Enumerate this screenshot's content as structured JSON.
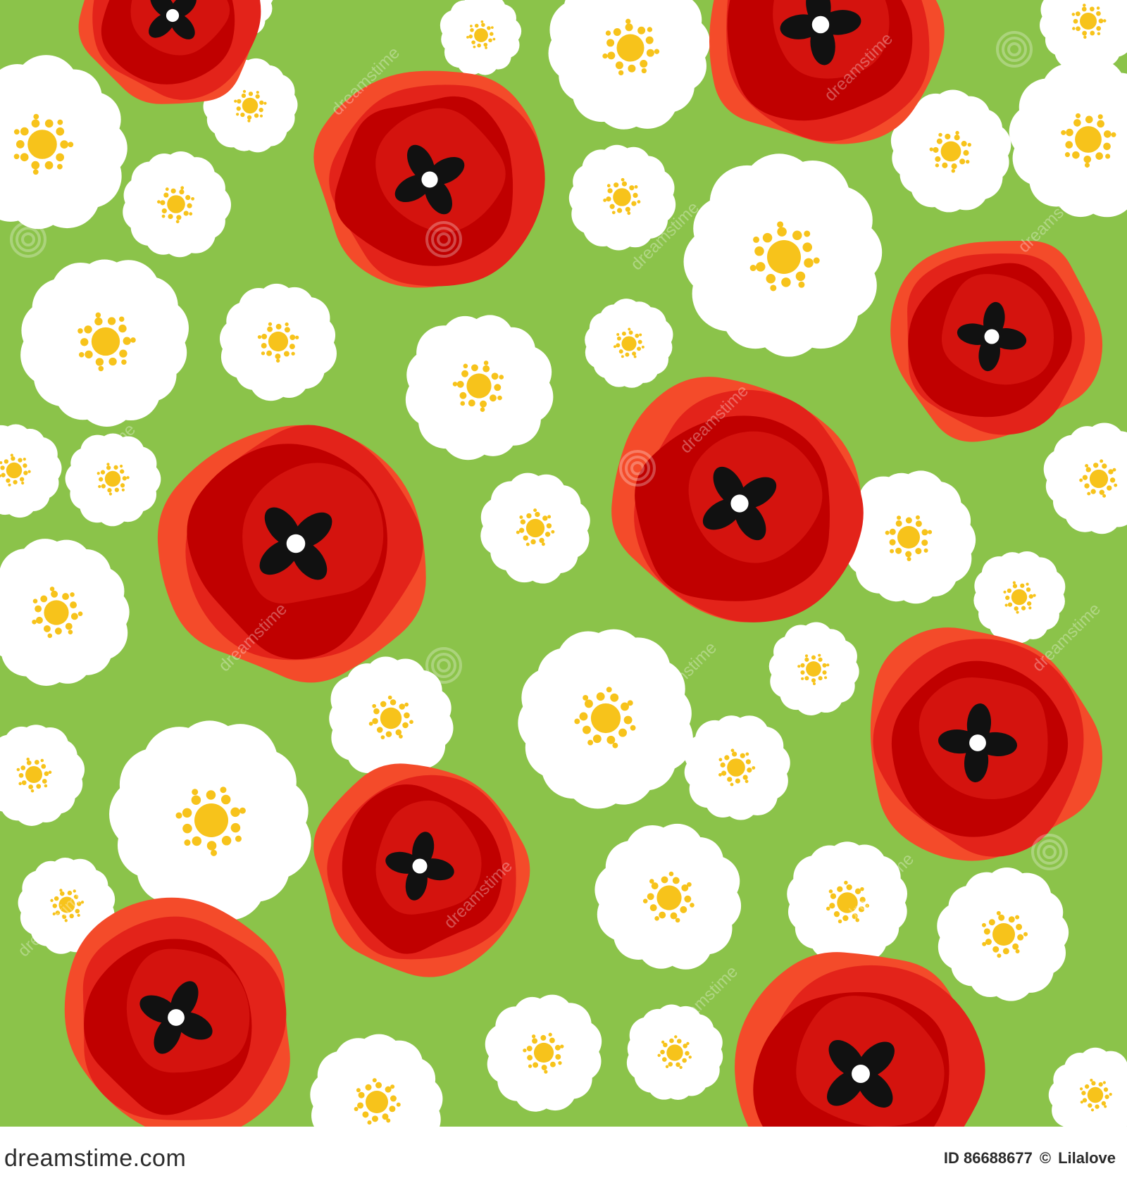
{
  "image": {
    "description": "",
    "background_color": "#8bc34a",
    "accent_colors": {
      "poppy_outer": "#f44b2a",
      "poppy_mid": "#e3231a",
      "poppy_inner": "#c00000",
      "poppy_center": "#111111",
      "daisy_petal": "#ffffff",
      "daisy_center": "#f7c31b",
      "footer_background": "#ffffff"
    }
  },
  "watermark": {
    "text": "dreamstime"
  },
  "footer": {
    "logo_text": "dreamstime.com",
    "id_label": "ID 86688677",
    "copyright_icon": "copyright-icon",
    "author": "Lilalove"
  }
}
